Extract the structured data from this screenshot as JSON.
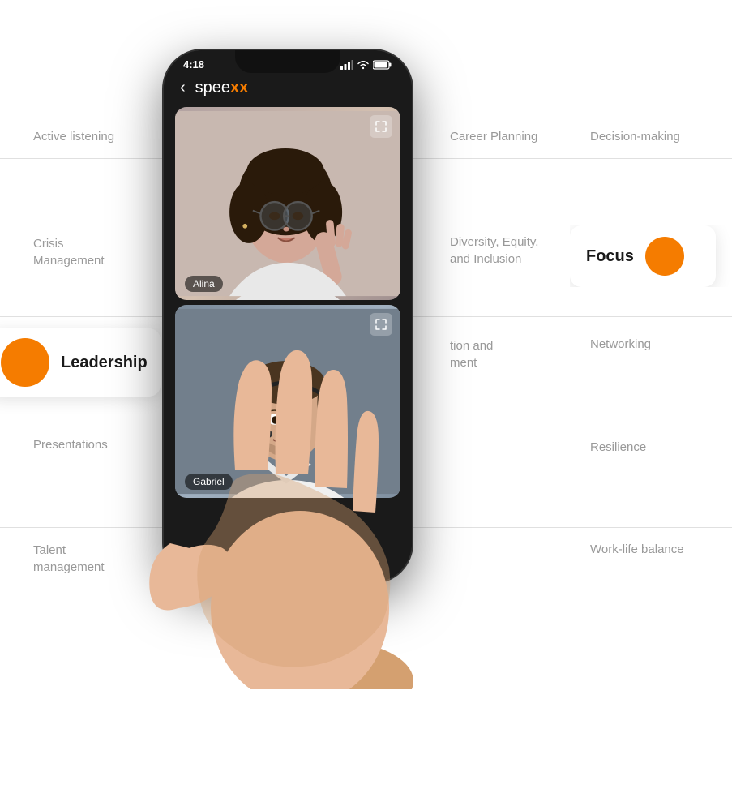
{
  "skills": {
    "active_listening": "Active listening",
    "career_planning": "Career Planning",
    "decision_making": "Decision-making",
    "crisis_management": "Crisis\nManagement",
    "diversity": "Diversity, Equity,\nand Inclusion",
    "networking": "Networking",
    "presentations": "Presentations",
    "resilience": "Resilience",
    "talent_management": "Talent\nmanagement",
    "work_life_balance": "Work-life balance",
    "innovation": "tion and\nment",
    "leadership": "Leadership",
    "focus": "Focus"
  },
  "phone": {
    "time": "4:18",
    "app_name_start": "speexx",
    "app_name_x": "x",
    "person1_name": "Alina",
    "person2_name": "Gabriel"
  },
  "cards": {
    "leadership_label": "Leadership",
    "focus_label": "Focus"
  }
}
